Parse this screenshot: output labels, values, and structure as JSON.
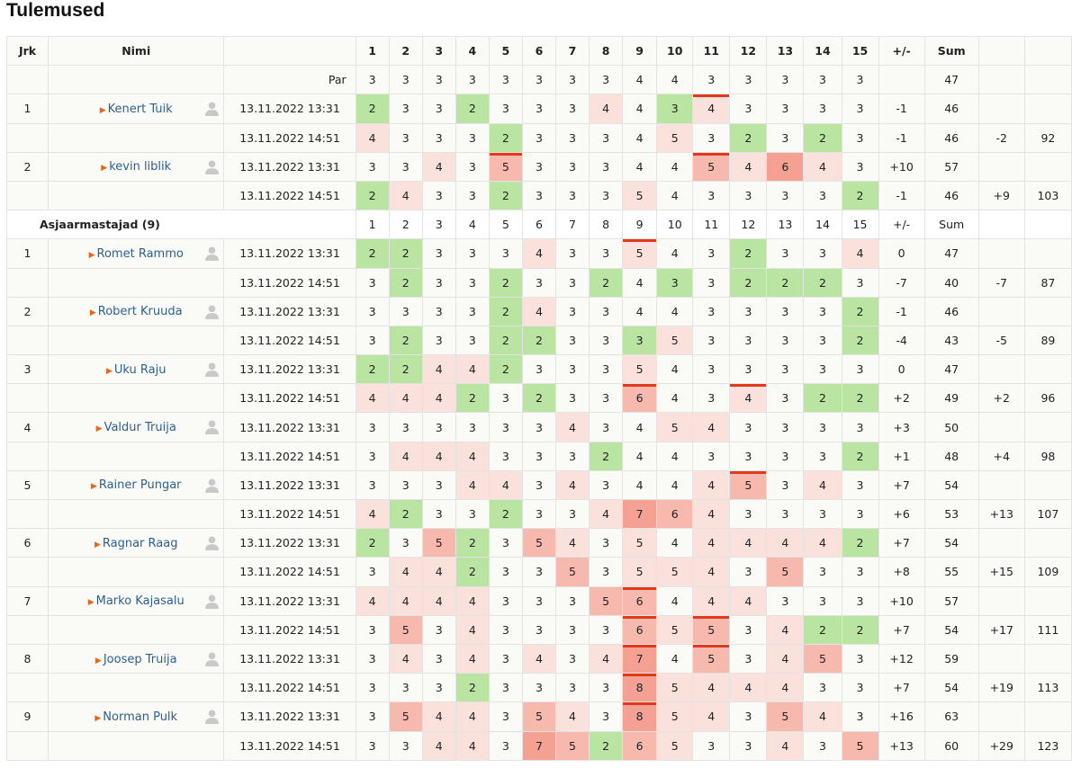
{
  "page": {
    "title": "Tulemused"
  },
  "table": {
    "headers": {
      "jrk": "Jrk",
      "nimi": "Nimi",
      "holes": [
        "1",
        "2",
        "3",
        "4",
        "5",
        "6",
        "7",
        "8",
        "9",
        "10",
        "11",
        "12",
        "13",
        "14",
        "15"
      ],
      "pm": "+/-",
      "sum": "Sum"
    },
    "par": {
      "label": "Par",
      "values": [
        3,
        3,
        3,
        3,
        3,
        3,
        3,
        3,
        4,
        4,
        3,
        3,
        3,
        3,
        3
      ],
      "sum": "47"
    },
    "groups": [
      {
        "category": null,
        "players": [
          {
            "rank": "1",
            "name": "Kenert Tuik",
            "rounds": [
              {
                "date": "13.11.2022 13:31",
                "scores": [
                  2,
                  3,
                  3,
                  2,
                  3,
                  3,
                  3,
                  4,
                  4,
                  3,
                  4,
                  3,
                  3,
                  3,
                  3
                ],
                "hot": [
                  11
                ],
                "pm": "-1",
                "sum": "46",
                "total_pm": "",
                "total": ""
              },
              {
                "date": "13.11.2022 14:51",
                "scores": [
                  4,
                  3,
                  3,
                  3,
                  2,
                  3,
                  3,
                  3,
                  4,
                  5,
                  3,
                  2,
                  3,
                  2,
                  3
                ],
                "hot": [],
                "pm": "-1",
                "sum": "46",
                "total_pm": "-2",
                "total": "92"
              }
            ]
          },
          {
            "rank": "2",
            "name": "kevin liblik",
            "rounds": [
              {
                "date": "13.11.2022 13:31",
                "scores": [
                  3,
                  3,
                  4,
                  3,
                  5,
                  3,
                  3,
                  3,
                  4,
                  4,
                  5,
                  4,
                  6,
                  4,
                  3
                ],
                "hot": [
                  5,
                  11
                ],
                "pm": "+10",
                "sum": "57",
                "total_pm": "",
                "total": ""
              },
              {
                "date": "13.11.2022 14:51",
                "scores": [
                  2,
                  4,
                  3,
                  3,
                  2,
                  3,
                  3,
                  3,
                  5,
                  4,
                  3,
                  3,
                  3,
                  3,
                  2
                ],
                "hot": [],
                "pm": "-1",
                "sum": "46",
                "total_pm": "+9",
                "total": "103"
              }
            ]
          }
        ]
      },
      {
        "category": "Asjaarmastajad (9)",
        "players": [
          {
            "rank": "1",
            "name": "Romet Rammo",
            "rounds": [
              {
                "date": "13.11.2022 13:31",
                "scores": [
                  2,
                  2,
                  3,
                  3,
                  3,
                  4,
                  3,
                  3,
                  5,
                  4,
                  3,
                  2,
                  3,
                  3,
                  4
                ],
                "hot": [
                  9
                ],
                "pm": "0",
                "sum": "47",
                "total_pm": "",
                "total": ""
              },
              {
                "date": "13.11.2022 14:51",
                "scores": [
                  3,
                  2,
                  3,
                  3,
                  2,
                  3,
                  3,
                  2,
                  4,
                  3,
                  3,
                  2,
                  2,
                  2,
                  3
                ],
                "hot": [],
                "pm": "-7",
                "sum": "40",
                "total_pm": "-7",
                "total": "87"
              }
            ]
          },
          {
            "rank": "2",
            "name": "Robert Kruuda",
            "rounds": [
              {
                "date": "13.11.2022 13:31",
                "scores": [
                  3,
                  3,
                  3,
                  3,
                  2,
                  4,
                  3,
                  3,
                  4,
                  4,
                  3,
                  3,
                  3,
                  3,
                  2
                ],
                "hot": [],
                "pm": "-1",
                "sum": "46",
                "total_pm": "",
                "total": ""
              },
              {
                "date": "13.11.2022 14:51",
                "scores": [
                  3,
                  2,
                  3,
                  3,
                  2,
                  2,
                  3,
                  3,
                  3,
                  5,
                  3,
                  3,
                  3,
                  3,
                  2
                ],
                "hot": [],
                "pm": "-4",
                "sum": "43",
                "total_pm": "-5",
                "total": "89"
              }
            ]
          },
          {
            "rank": "3",
            "name": "Uku Raju",
            "rounds": [
              {
                "date": "13.11.2022 13:31",
                "scores": [
                  2,
                  2,
                  4,
                  4,
                  2,
                  3,
                  3,
                  3,
                  5,
                  4,
                  3,
                  3,
                  3,
                  3,
                  3
                ],
                "hot": [],
                "pm": "0",
                "sum": "47",
                "total_pm": "",
                "total": ""
              },
              {
                "date": "13.11.2022 14:51",
                "scores": [
                  4,
                  4,
                  4,
                  2,
                  3,
                  2,
                  3,
                  3,
                  6,
                  4,
                  3,
                  4,
                  3,
                  2,
                  2
                ],
                "hot": [
                  9,
                  12
                ],
                "pm": "+2",
                "sum": "49",
                "total_pm": "+2",
                "total": "96"
              }
            ]
          },
          {
            "rank": "4",
            "name": "Valdur Truija",
            "rounds": [
              {
                "date": "13.11.2022 13:31",
                "scores": [
                  3,
                  3,
                  3,
                  3,
                  3,
                  3,
                  4,
                  3,
                  4,
                  5,
                  4,
                  3,
                  3,
                  3,
                  3
                ],
                "hot": [],
                "pm": "+3",
                "sum": "50",
                "total_pm": "",
                "total": ""
              },
              {
                "date": "13.11.2022 14:51",
                "scores": [
                  3,
                  4,
                  4,
                  4,
                  3,
                  3,
                  3,
                  2,
                  4,
                  4,
                  3,
                  3,
                  3,
                  3,
                  2
                ],
                "hot": [],
                "pm": "+1",
                "sum": "48",
                "total_pm": "+4",
                "total": "98"
              }
            ]
          },
          {
            "rank": "5",
            "name": "Rainer Pungar",
            "rounds": [
              {
                "date": "13.11.2022 13:31",
                "scores": [
                  3,
                  3,
                  3,
                  4,
                  4,
                  3,
                  4,
                  3,
                  4,
                  4,
                  4,
                  5,
                  3,
                  4,
                  3
                ],
                "hot": [
                  12
                ],
                "pm": "+7",
                "sum": "54",
                "total_pm": "",
                "total": ""
              },
              {
                "date": "13.11.2022 14:51",
                "scores": [
                  4,
                  2,
                  3,
                  3,
                  2,
                  3,
                  3,
                  4,
                  7,
                  6,
                  4,
                  3,
                  3,
                  3,
                  3
                ],
                "hot": [],
                "pm": "+6",
                "sum": "53",
                "total_pm": "+13",
                "total": "107"
              }
            ]
          },
          {
            "rank": "6",
            "name": "Ragnar Raag",
            "rounds": [
              {
                "date": "13.11.2022 13:31",
                "scores": [
                  2,
                  3,
                  5,
                  2,
                  3,
                  5,
                  4,
                  3,
                  5,
                  4,
                  4,
                  4,
                  4,
                  4,
                  2
                ],
                "hot": [],
                "pm": "+7",
                "sum": "54",
                "total_pm": "",
                "total": ""
              },
              {
                "date": "13.11.2022 14:51",
                "scores": [
                  3,
                  4,
                  4,
                  2,
                  3,
                  3,
                  5,
                  3,
                  5,
                  5,
                  4,
                  3,
                  5,
                  3,
                  3
                ],
                "hot": [],
                "pm": "+8",
                "sum": "55",
                "total_pm": "+15",
                "total": "109"
              }
            ]
          },
          {
            "rank": "7",
            "name": "Marko Kajasalu",
            "rounds": [
              {
                "date": "13.11.2022 13:31",
                "scores": [
                  4,
                  4,
                  4,
                  4,
                  3,
                  3,
                  3,
                  5,
                  6,
                  4,
                  4,
                  4,
                  3,
                  3,
                  3
                ],
                "hot": [
                  9
                ],
                "pm": "+10",
                "sum": "57",
                "total_pm": "",
                "total": ""
              },
              {
                "date": "13.11.2022 14:51",
                "scores": [
                  3,
                  5,
                  3,
                  4,
                  3,
                  3,
                  3,
                  3,
                  6,
                  5,
                  5,
                  3,
                  4,
                  2,
                  2
                ],
                "hot": [
                  9,
                  11
                ],
                "pm": "+7",
                "sum": "54",
                "total_pm": "+17",
                "total": "111"
              }
            ]
          },
          {
            "rank": "8",
            "name": "Joosep Truija",
            "rounds": [
              {
                "date": "13.11.2022 13:31",
                "scores": [
                  3,
                  4,
                  3,
                  4,
                  3,
                  4,
                  3,
                  4,
                  7,
                  4,
                  5,
                  3,
                  4,
                  5,
                  3
                ],
                "hot": [
                  9,
                  11
                ],
                "pm": "+12",
                "sum": "59",
                "total_pm": "",
                "total": ""
              },
              {
                "date": "13.11.2022 14:51",
                "scores": [
                  3,
                  3,
                  3,
                  2,
                  3,
                  3,
                  3,
                  3,
                  8,
                  5,
                  4,
                  4,
                  4,
                  3,
                  3
                ],
                "hot": [
                  9
                ],
                "pm": "+7",
                "sum": "54",
                "total_pm": "+19",
                "total": "113"
              }
            ]
          },
          {
            "rank": "9",
            "name": "Norman Pulk",
            "rounds": [
              {
                "date": "13.11.2022 13:31",
                "scores": [
                  3,
                  5,
                  4,
                  4,
                  3,
                  5,
                  4,
                  3,
                  8,
                  5,
                  4,
                  3,
                  5,
                  4,
                  3
                ],
                "hot": [
                  9
                ],
                "pm": "+16",
                "sum": "63",
                "total_pm": "",
                "total": ""
              },
              {
                "date": "13.11.2022 14:51",
                "scores": [
                  3,
                  3,
                  4,
                  4,
                  3,
                  7,
                  5,
                  2,
                  6,
                  5,
                  3,
                  3,
                  4,
                  3,
                  5
                ],
                "hot": [],
                "pm": "+13",
                "sum": "60",
                "total_pm": "+29",
                "total": "123"
              }
            ]
          }
        ]
      }
    ]
  },
  "colors": {
    "birdie": "#b9e4a2",
    "bogey": "#fbe1dc",
    "double_bogey": "#f7b9ad",
    "triple_plus": "#f4a093",
    "hot_marker": "#e2391b",
    "link": "#2d5f8f",
    "arrow": "#e8661b"
  },
  "icons": {
    "player": "person-icon",
    "expand": "triangle-right-icon"
  }
}
